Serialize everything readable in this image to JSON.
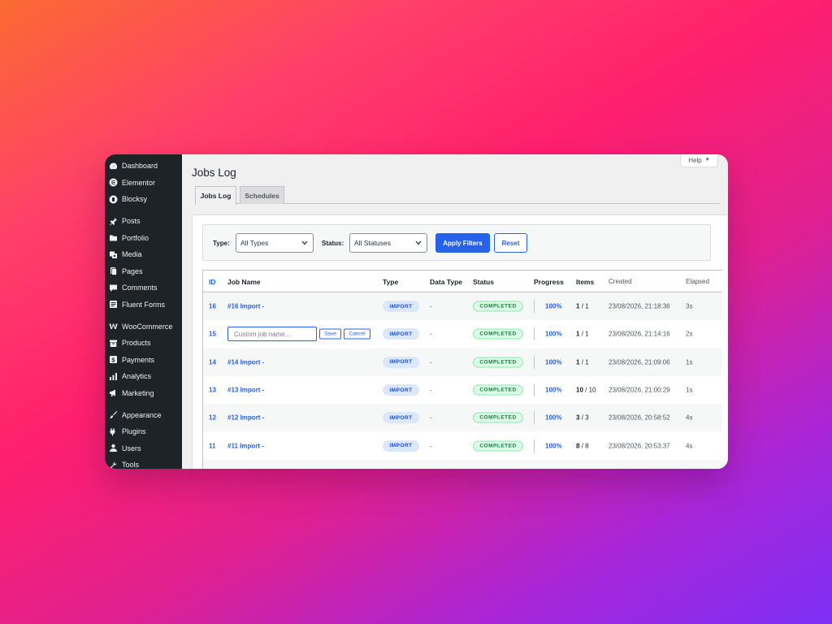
{
  "sidebar": {
    "items": [
      {
        "label": "Dashboard",
        "icon": "dashboard-icon"
      },
      {
        "label": "Elementor",
        "icon": "elementor-icon"
      },
      {
        "label": "Blocksy",
        "icon": "blocksy-icon"
      },
      {
        "label": "Posts",
        "icon": "pin-icon"
      },
      {
        "label": "Portfolio",
        "icon": "folder-icon"
      },
      {
        "label": "Media",
        "icon": "media-icon"
      },
      {
        "label": "Pages",
        "icon": "pages-icon"
      },
      {
        "label": "Comments",
        "icon": "comment-icon"
      },
      {
        "label": "Fluent Forms",
        "icon": "forms-icon"
      },
      {
        "label": "WooCommerce",
        "icon": "woo-icon"
      },
      {
        "label": "Products",
        "icon": "archive-icon"
      },
      {
        "label": "Payments",
        "icon": "dollar-icon"
      },
      {
        "label": "Analytics",
        "icon": "chart-bar-icon"
      },
      {
        "label": "Marketing",
        "icon": "megaphone-icon"
      },
      {
        "label": "Appearance",
        "icon": "brush-icon"
      },
      {
        "label": "Plugins",
        "icon": "plug-icon"
      },
      {
        "label": "Users",
        "icon": "user-icon"
      },
      {
        "label": "Tools",
        "icon": "wrench-icon"
      }
    ]
  },
  "help": {
    "label": "Help"
  },
  "page": {
    "title": "Jobs Log"
  },
  "tabs": [
    {
      "label": "Jobs Log",
      "active": true
    },
    {
      "label": "Schedules",
      "active": false
    }
  ],
  "filters": {
    "type_label": "Type:",
    "type_value": "All Types",
    "status_label": "Status:",
    "status_value": "All Statuses",
    "apply_label": "Apply Filters",
    "reset_label": "Reset"
  },
  "table": {
    "headers": {
      "id": "ID",
      "name": "Job Name",
      "type": "Type",
      "data_type": "Data Type",
      "status": "Status",
      "progress": "Progress",
      "items": "Items",
      "created": "Created",
      "elapsed": "Elapsed"
    },
    "edit_row": {
      "placeholder": "Custom job name...",
      "save": "Save",
      "cancel": "Cancel"
    },
    "rows": [
      {
        "id": "16",
        "name": "#16 Import -",
        "type": "IMPORT",
        "data_type": "-",
        "status": "COMPLETED",
        "progress": "100%",
        "items_done": "1",
        "items_total": "/ 1",
        "created": "23/08/2026, 21:18:36",
        "elapsed": "3s",
        "editing": false
      },
      {
        "id": "15",
        "name": "",
        "type": "IMPORT",
        "data_type": "-",
        "status": "COMPLETED",
        "progress": "100%",
        "items_done": "1",
        "items_total": "/ 1",
        "created": "23/08/2026, 21:14:16",
        "elapsed": "2s",
        "editing": true
      },
      {
        "id": "14",
        "name": "#14 Import -",
        "type": "IMPORT",
        "data_type": "-",
        "status": "COMPLETED",
        "progress": "100%",
        "items_done": "1",
        "items_total": "/ 1",
        "created": "23/08/2026, 21:09:06",
        "elapsed": "1s",
        "editing": false
      },
      {
        "id": "13",
        "name": "#13 Import -",
        "type": "IMPORT",
        "data_type": "-",
        "status": "COMPLETED",
        "progress": "100%",
        "items_done": "10",
        "items_total": "/ 10",
        "created": "23/08/2026, 21:00:29",
        "elapsed": "1s",
        "editing": false
      },
      {
        "id": "12",
        "name": "#12 Import -",
        "type": "IMPORT",
        "data_type": "-",
        "status": "COMPLETED",
        "progress": "100%",
        "items_done": "3",
        "items_total": "/ 3",
        "created": "23/08/2026, 20:58:52",
        "elapsed": "4s",
        "editing": false
      },
      {
        "id": "11",
        "name": "#11 Import -",
        "type": "IMPORT",
        "data_type": "-",
        "status": "COMPLETED",
        "progress": "100%",
        "items_done": "8",
        "items_total": "/ 8",
        "created": "23/08/2026, 20:53:37",
        "elapsed": "4s",
        "editing": false
      }
    ]
  },
  "colors": {
    "accent": "#2563eb",
    "sidebar_bg": "#1d2327",
    "success": "#15803d"
  }
}
